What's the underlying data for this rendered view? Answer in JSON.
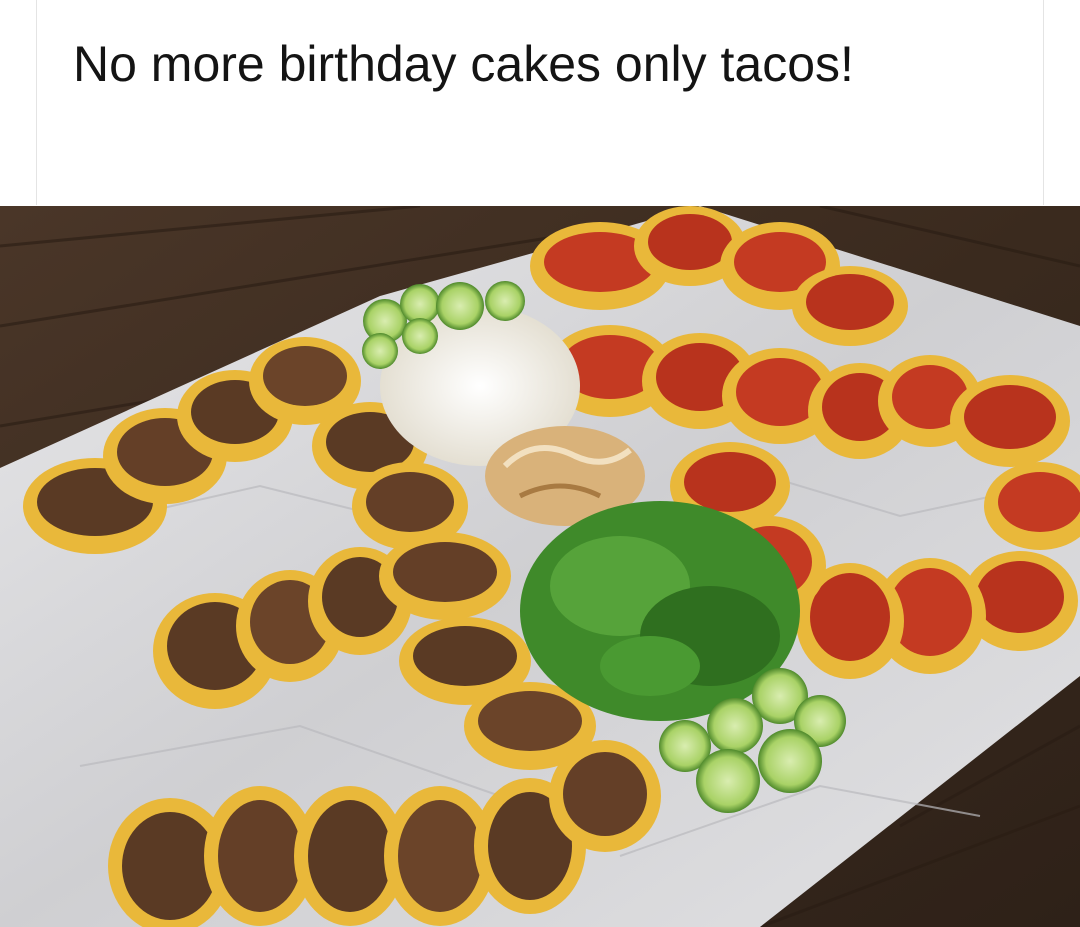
{
  "post": {
    "caption": "No more birthday cakes only tacos!"
  },
  "photo": {
    "subject": "photo",
    "palette": {
      "wood_dark": "#3a2a1e",
      "wood_light": "#5a4433",
      "foil": "#d6d6d8",
      "tortilla": "#e9b83a",
      "beef": "#5a3a24",
      "chorizo": "#c43a22",
      "onion": "#f4f1ea",
      "cilantro": "#3f8a2a",
      "lime": "#8fc04a"
    }
  }
}
